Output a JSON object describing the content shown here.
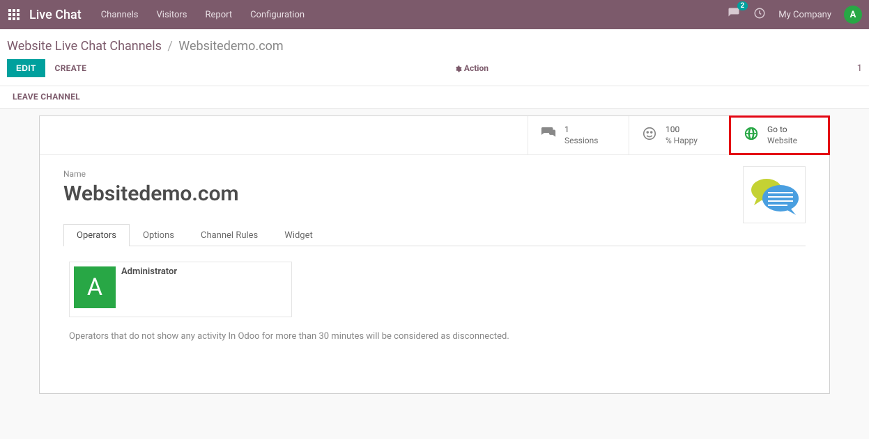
{
  "nav": {
    "app_title": "Live Chat",
    "links": [
      "Channels",
      "Visitors",
      "Report",
      "Configuration"
    ],
    "chat_count": "2",
    "company": "My Company",
    "avatar_letter": "A"
  },
  "breadcrumb": {
    "root": "Website Live Chat Channels",
    "current": "Websitedemo.com"
  },
  "toolbar": {
    "edit": "EDIT",
    "create": "CREATE",
    "action": "Action",
    "page_n": "1"
  },
  "statusbar": {
    "leave": "LEAVE CHANNEL"
  },
  "stats": {
    "sessions_n": "1",
    "sessions_label": "Sessions",
    "happy_n": "100",
    "happy_label": "% Happy",
    "goto_line1": "Go to",
    "goto_line2": "Website"
  },
  "form": {
    "name_label": "Name",
    "name_value": "Websitedemo.com"
  },
  "tabs": [
    "Operators",
    "Options",
    "Channel Rules",
    "Widget"
  ],
  "operators": [
    {
      "name": "Administrator",
      "avatar_letter": "A"
    }
  ],
  "operators_note": "Operators that do not show any activity In Odoo for more than 30 minutes will be considered as disconnected."
}
